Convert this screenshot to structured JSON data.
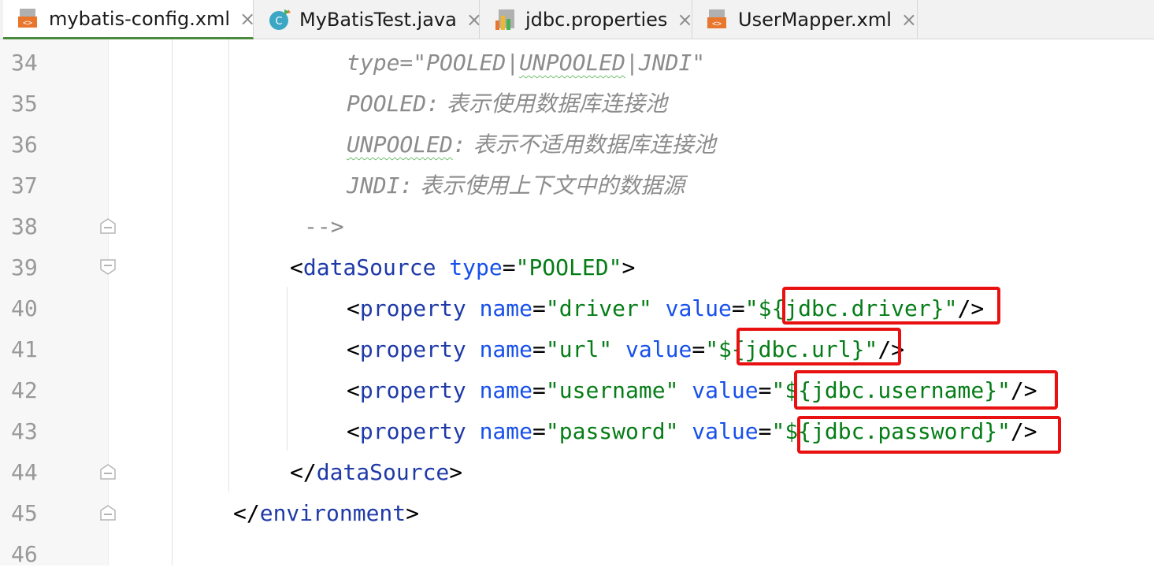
{
  "tabs": [
    {
      "label": "mybatis-config.xml",
      "icon": "xml-file-icon",
      "active": true
    },
    {
      "label": "MyBatisTest.java",
      "icon": "java-class-icon",
      "active": false
    },
    {
      "label": "jdbc.properties",
      "icon": "properties-file-icon",
      "active": false
    },
    {
      "label": "UserMapper.xml",
      "icon": "xml-file-icon",
      "active": false
    }
  ],
  "tab_close_glyph": "×",
  "line_numbers": [
    "34",
    "35",
    "36",
    "37",
    "38",
    "39",
    "40",
    "41",
    "42",
    "43",
    "44",
    "45",
    "46"
  ],
  "code": {
    "l34": {
      "text": "type=\"POOLED|",
      "squiggle": "UNPOOLED",
      "rest": "|JNDI\""
    },
    "l35": {
      "kw": "POOLED:",
      "cn": " 表示使用数据库连接池"
    },
    "l36": {
      "kw": "UNPOOLED",
      "colon": ":",
      "cn": " 表示不适用数据库连接池"
    },
    "l37": {
      "kw": "JNDI:",
      "cn": " 表示使用上下文中的数据源"
    },
    "l38": {
      "text": "-->"
    },
    "l39": {
      "open": "<",
      "tag": "dataSource",
      "attr": " type",
      "eq": "=",
      "val": "\"POOLED\"",
      "close": ">"
    },
    "l40": {
      "open": "<",
      "tag": "property",
      "attr1": " name",
      "eq": "=",
      "val1": "\"driver\"",
      "attr2": " value",
      "val2": "\"${jdbc.driver}\"",
      "close": "/>"
    },
    "l41": {
      "open": "<",
      "tag": "property",
      "attr1": " name",
      "eq": "=",
      "val1": "\"url\"",
      "attr2": " value",
      "val2": "\"${jdbc.url}\"",
      "close": "/>"
    },
    "l42": {
      "open": "<",
      "tag": "property",
      "attr1": " name",
      "eq": "=",
      "val1": "\"username\"",
      "attr2": " value",
      "val2": "\"${jdbc.username}\"",
      "close": "/>"
    },
    "l43": {
      "open": "<",
      "tag": "property",
      "attr1": " name",
      "eq": "=",
      "val1": "\"password\"",
      "attr2": " value",
      "val2": "\"${jdbc.password}\"",
      "close": "/>"
    },
    "l44": {
      "open": "</",
      "tag": "dataSource",
      "close": ">"
    },
    "l45": {
      "open": "</",
      "tag": "environment",
      "close": ">"
    }
  },
  "colors": {
    "tag": "#1f3aa8",
    "attribute": "#1750eb",
    "string": "#067d17",
    "comment": "#8c8c8c",
    "highlight_box": "#e81010",
    "line_number": "#999999"
  }
}
